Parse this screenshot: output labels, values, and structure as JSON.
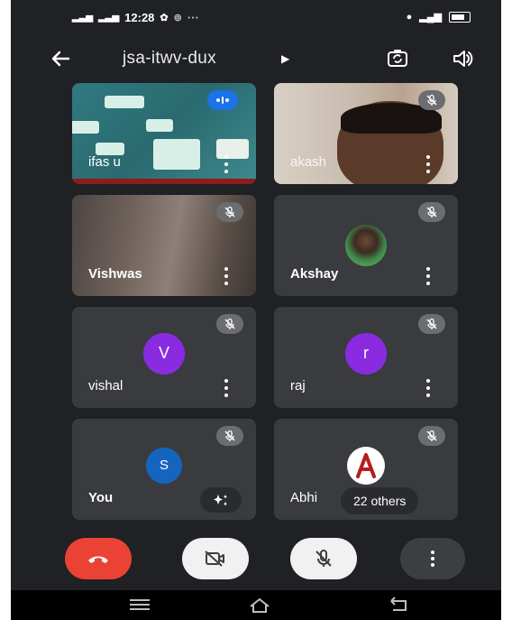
{
  "status": {
    "time": "12:28"
  },
  "meeting": {
    "code": "jsa-itwv-dux"
  },
  "tiles": [
    {
      "name": "ifas u"
    },
    {
      "name": "akash"
    },
    {
      "name": "Vishwas"
    },
    {
      "name": "Akshay"
    },
    {
      "name": "vishal",
      "initial": "V",
      "color": "#8a2be2"
    },
    {
      "name": "raj",
      "initial": "r",
      "color": "#8a2be2"
    },
    {
      "name": "You",
      "initial": "S",
      "color": "#1565c0"
    },
    {
      "name": "Abhi",
      "overflow_label": "22 others"
    }
  ],
  "colors": {
    "end_call": "#ea4335",
    "control_light": "#f1f1f1",
    "control_dark": "#3c3e41"
  },
  "icons": [
    "back-arrow-icon",
    "camera-switch-icon",
    "speaker-icon",
    "mic-off-icon",
    "more-vert-icon",
    "end-call-icon",
    "camera-off-icon",
    "sparkle-effects-icon"
  ]
}
